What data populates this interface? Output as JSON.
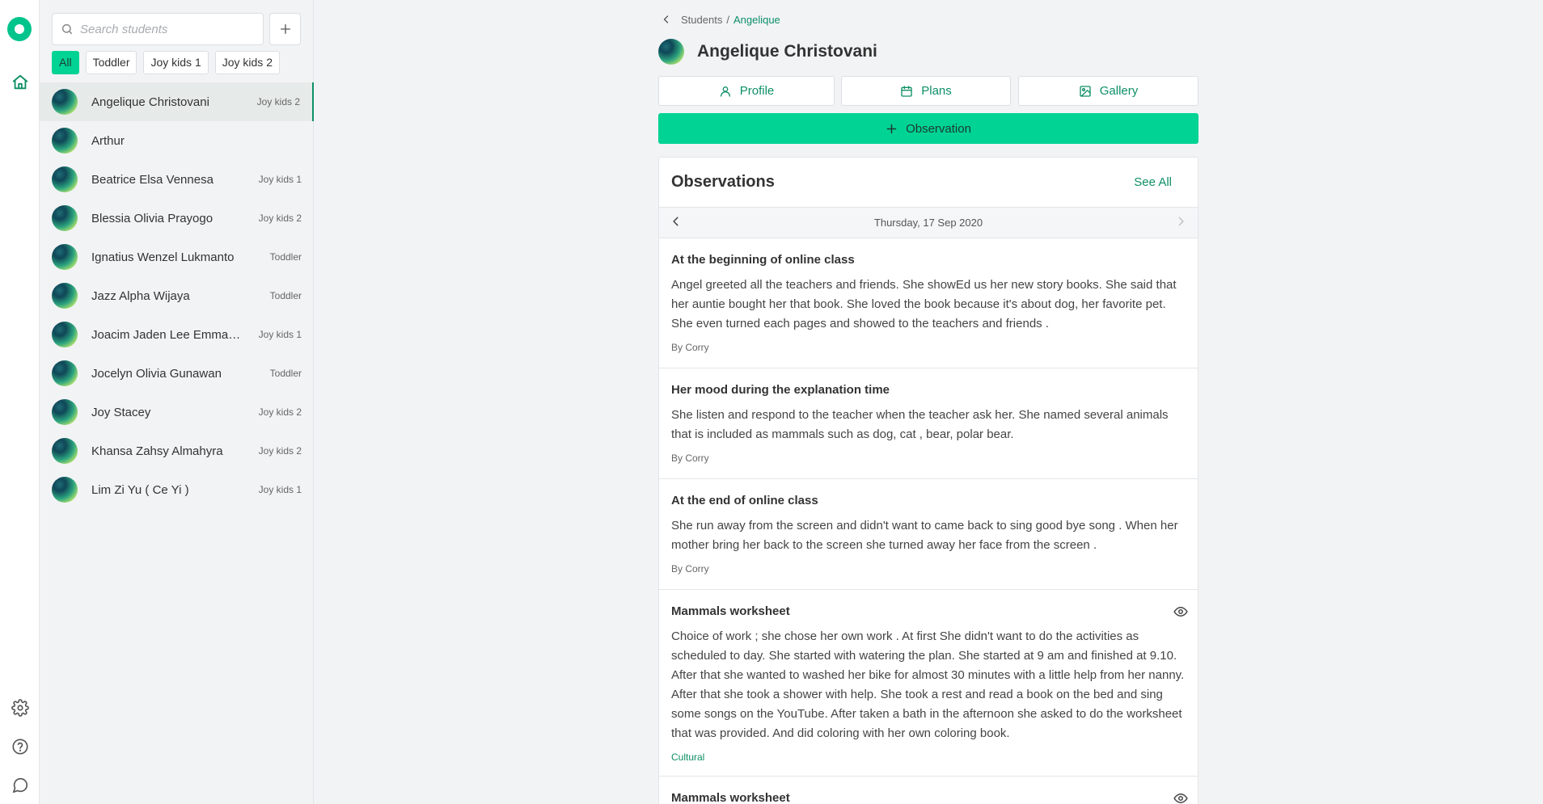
{
  "search": {
    "placeholder": "Search students"
  },
  "filters": [
    "All",
    "Toddler",
    "Joy kids 1",
    "Joy kids 2"
  ],
  "students": [
    {
      "name": "Angelique Christovani",
      "class": "Joy kids 2"
    },
    {
      "name": "Arthur",
      "class": ""
    },
    {
      "name": "Beatrice Elsa Vennesa",
      "class": "Joy kids 1"
    },
    {
      "name": "Blessia Olivia Prayogo",
      "class": "Joy kids 2"
    },
    {
      "name": "Ignatius Wenzel Lukmanto",
      "class": "Toddler"
    },
    {
      "name": "Jazz Alpha Wijaya",
      "class": "Toddler"
    },
    {
      "name": "Joacim Jaden Lee Emmanu...",
      "class": "Joy kids 1"
    },
    {
      "name": "Jocelyn Olivia Gunawan",
      "class": "Toddler"
    },
    {
      "name": "Joy Stacey",
      "class": "Joy kids 2"
    },
    {
      "name": "Khansa Zahsy Almahyra",
      "class": "Joy kids 2"
    },
    {
      "name": "Lim Zi Yu ( Ce Yi )",
      "class": "Joy kids 1"
    }
  ],
  "breadcrumb": {
    "parent": "Students",
    "separator": "/",
    "current": "Angelique"
  },
  "student": {
    "full_name": "Angelique Christovani"
  },
  "tabs": {
    "profile": "Profile",
    "plans": "Plans",
    "gallery": "Gallery"
  },
  "observation_button": "Observation",
  "observations": {
    "title": "Observations",
    "see_all": "See All",
    "date": "Thursday, 17 Sep 2020",
    "items": [
      {
        "title": "At the beginning of online class",
        "body": "Angel greeted all the teachers and friends. She showEd us her new story books. She said that her auntie bought her that book. She loved the book because it's about dog, her favorite pet. She even turned each pages and showed to the teachers and friends .",
        "author": "By Corry"
      },
      {
        "title": "Her mood during the explanation time",
        "body": "She listen and respond to the teacher when the teacher ask her. She named several animals that is included as mammals such as dog, cat , bear, polar bear.",
        "author": "By Corry"
      },
      {
        "title": "At the end of online class",
        "body": "She run away from the screen and didn't want to came back to sing good bye song . When her mother bring her back to the screen she turned away her face from the screen .",
        "author": "By Corry"
      },
      {
        "title": "Mammals worksheet",
        "body": "Choice of work ; she chose her own work . At first She didn't want to do the activities as scheduled to day. She started with watering the plan. She started at 9 am and finished at 9.10. After that she wanted to washed her bike for almost 30 minutes with a little help from her nanny. After that she took a shower with help. She took a rest and read a book on the bed and sing some songs on the YouTube. After taken a bath in the afternoon she asked to do the worksheet that was provided. And did coloring with her own coloring book.",
        "tag": "Cultural"
      },
      {
        "title": "Mammals worksheet"
      }
    ]
  },
  "colors": {
    "accent": "#00d394",
    "accent_text": "#0d8f66",
    "background": "#f2f3f5"
  }
}
